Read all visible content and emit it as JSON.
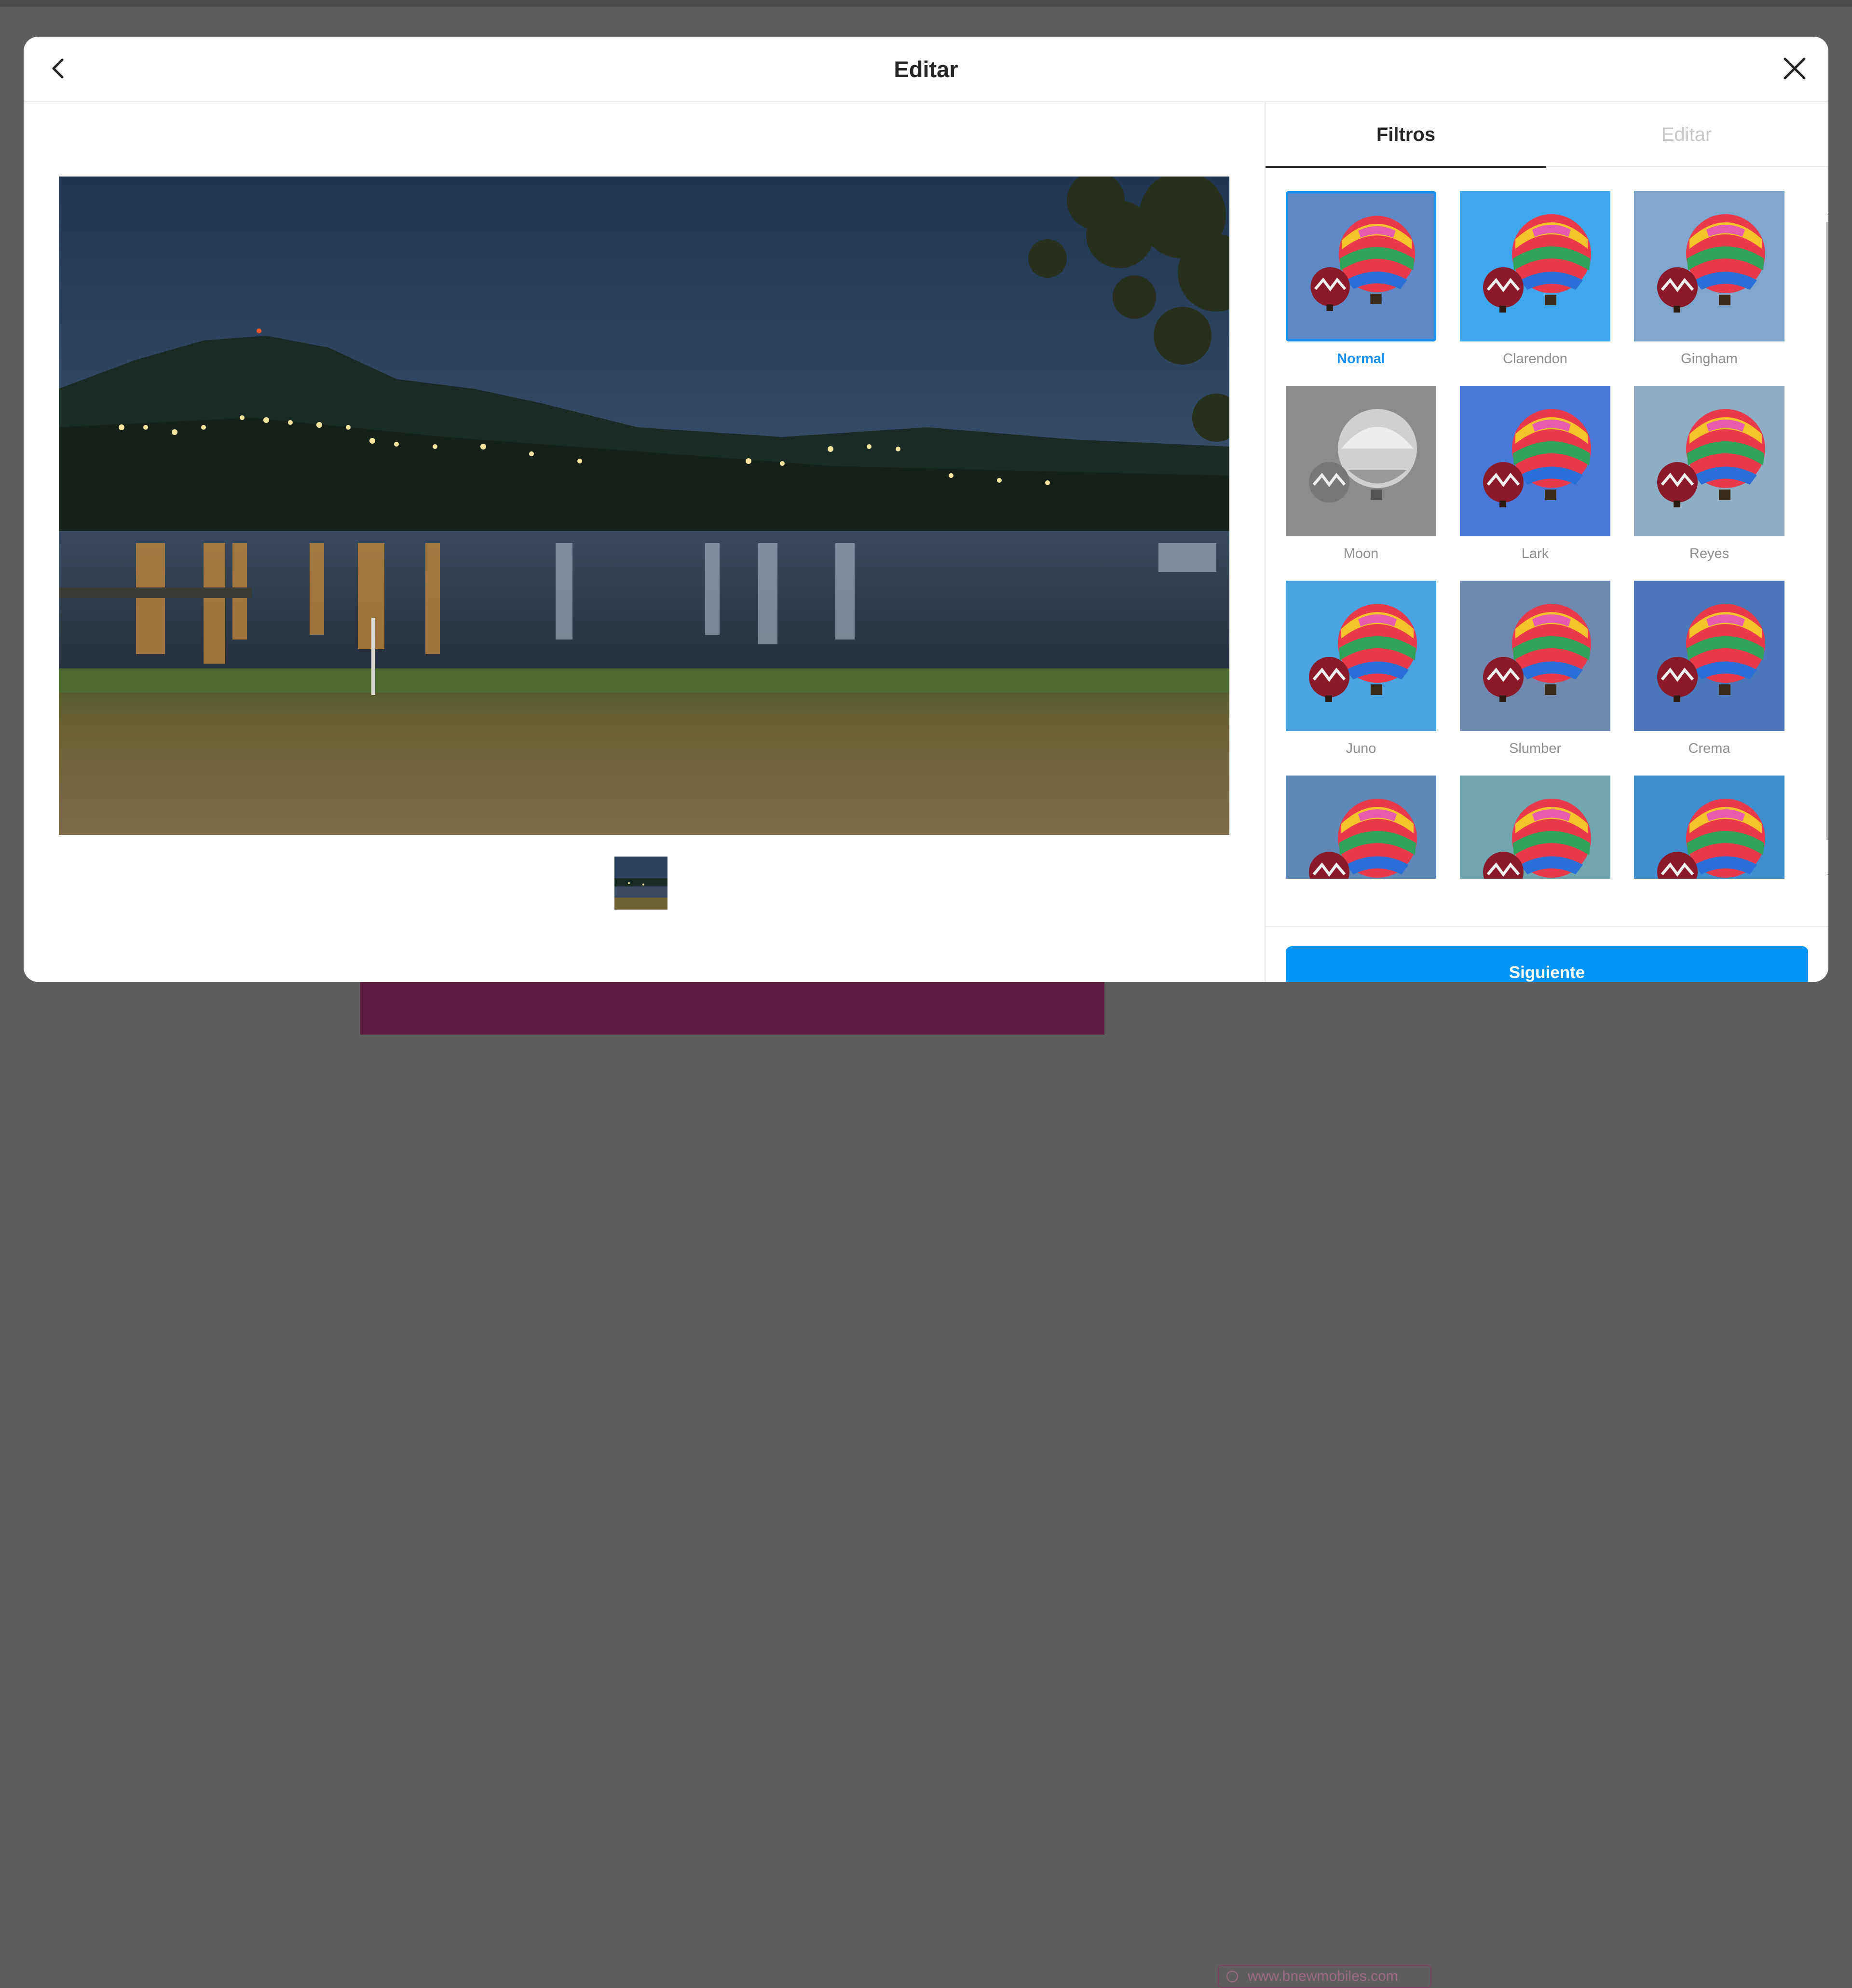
{
  "modal": {
    "title": "Editar",
    "back_icon": "chevron-left-icon",
    "close_icon": "close-icon"
  },
  "tabs": [
    {
      "label": "Filtros",
      "active": true
    },
    {
      "label": "Editar",
      "active": false
    }
  ],
  "filters": [
    {
      "name": "Normal",
      "selected": true,
      "tone": "#5f88c6"
    },
    {
      "name": "Clarendon",
      "selected": false,
      "tone": "#3fa8ec"
    },
    {
      "name": "Gingham",
      "selected": false,
      "tone": "#7fa6cc"
    },
    {
      "name": "Moon",
      "selected": false,
      "tone": "#8c8c8c"
    },
    {
      "name": "Lark",
      "selected": false,
      "tone": "#4a78d8"
    },
    {
      "name": "Reyes",
      "selected": false,
      "tone": "#8eaec6"
    },
    {
      "name": "Juno",
      "selected": false,
      "tone": "#4aa3e0"
    },
    {
      "name": "Slumber",
      "selected": false,
      "tone": "#6f88ad"
    },
    {
      "name": "Crema",
      "selected": false,
      "tone": "#4a78b8"
    },
    {
      "name": "",
      "selected": false,
      "tone": "#5f88b6"
    },
    {
      "name": "",
      "selected": false,
      "tone": "#6fa6b0"
    },
    {
      "name": "",
      "selected": false,
      "tone": "#3f8fd0"
    }
  ],
  "next_button": "Siguiente",
  "background": {
    "watermark": "www.bnewmobiles.com"
  },
  "colors": {
    "accent": "#0095f6",
    "selected_filter": "#1b8ff2"
  }
}
